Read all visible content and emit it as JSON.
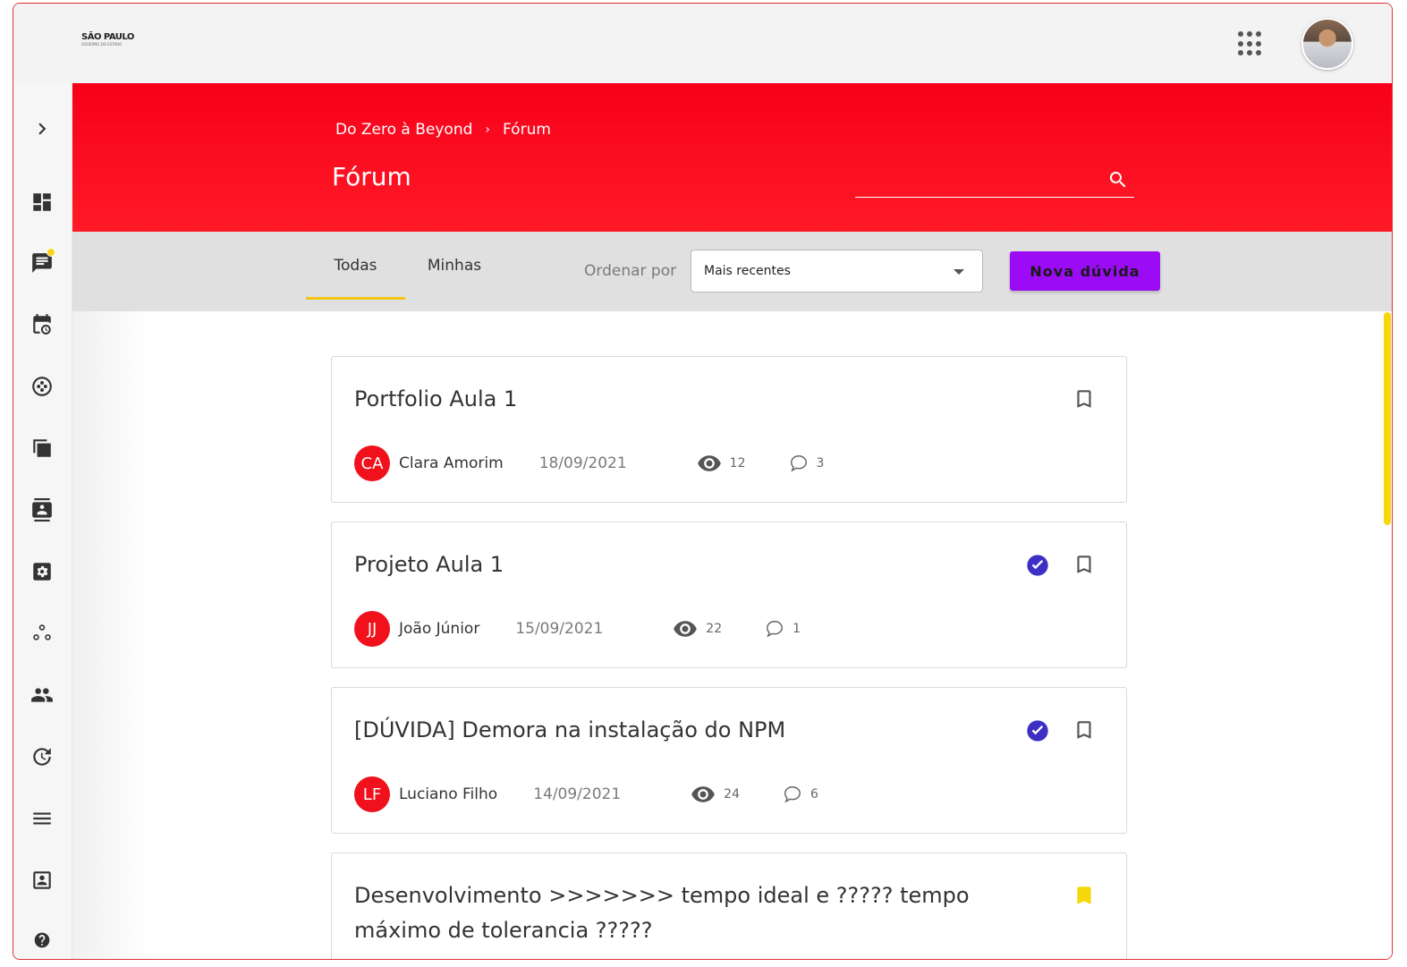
{
  "header": {
    "logo_text": "SÃO PAULO",
    "logo_sub": "GOVERNO DO ESTADO"
  },
  "sidebar": {
    "items": [
      {
        "name": "expand",
        "icon": "chevron-right-icon"
      },
      {
        "name": "dashboard",
        "icon": "dashboard-icon"
      },
      {
        "name": "forum",
        "icon": "chat-icon",
        "badge": true
      },
      {
        "name": "schedule",
        "icon": "calendar-clock-icon"
      },
      {
        "name": "gallery",
        "icon": "aperture-icon"
      },
      {
        "name": "library",
        "icon": "stacked-cards-icon"
      },
      {
        "name": "contacts",
        "icon": "contact-book-icon"
      },
      {
        "name": "settings",
        "icon": "gear-box-icon"
      },
      {
        "name": "groups",
        "icon": "hub-icon"
      },
      {
        "name": "people",
        "icon": "people-icon"
      },
      {
        "name": "history",
        "icon": "history-icon"
      },
      {
        "name": "menu",
        "icon": "menu-icon"
      },
      {
        "name": "profile",
        "icon": "account-box-icon"
      },
      {
        "name": "help",
        "icon": "help-icon"
      }
    ]
  },
  "breadcrumb": {
    "parent": "Do Zero à Beyond",
    "separator": "›",
    "current": "Fórum"
  },
  "page": {
    "title": "Fórum"
  },
  "search": {
    "placeholder": ""
  },
  "toolbar": {
    "tab_all": "Todas",
    "tab_mine": "Minhas",
    "order_label": "Ordenar por",
    "order_value": "Mais recentes",
    "new_button": "Nova dúvida"
  },
  "posts": [
    {
      "title": "Portfolio Aula 1",
      "initials": "CA",
      "author": "Clara Amorim",
      "date": "18/09/2021",
      "views": "12",
      "comments": "3",
      "solved": false,
      "bookmarked": false
    },
    {
      "title": "Projeto Aula 1",
      "initials": "JJ",
      "author": "João Júnior",
      "date": "15/09/2021",
      "views": "22",
      "comments": "1",
      "solved": true,
      "bookmarked": false
    },
    {
      "title": "[DÚVIDA] Demora na instalação do NPM",
      "initials": "LF",
      "author": "Luciano Filho",
      "date": "14/09/2021",
      "views": "24",
      "comments": "6",
      "solved": true,
      "bookmarked": false
    },
    {
      "title": "Desenvolvimento >>>>>>> tempo ideal e ????? tempo máximo de tolerancia ?????",
      "solved": false,
      "bookmarked": true
    }
  ],
  "colors": {
    "brand_red": "#f7001a",
    "accent_purple": "#9b0cf5",
    "tab_underline": "#f2c413",
    "solved_blue": "#3d2fc4",
    "bookmark_yellow": "#f5d80a"
  }
}
